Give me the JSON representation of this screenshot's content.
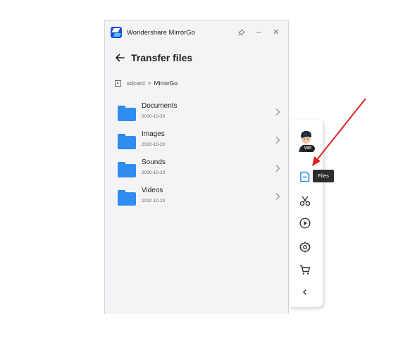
{
  "window": {
    "app_title": "Wondershare MirrorGo",
    "controls": {
      "pin": "pin-icon",
      "minimize": "–",
      "close": "✕"
    }
  },
  "header": {
    "title": "Transfer files"
  },
  "breadcrumb": {
    "root": "sdcard",
    "separator": ">",
    "current": "MirrorGo"
  },
  "folders": [
    {
      "name": "Documents",
      "date": "2020-10-20"
    },
    {
      "name": "Images",
      "date": "2020-10-20"
    },
    {
      "name": "Sounds",
      "date": "2020-10-20"
    },
    {
      "name": "Videos",
      "date": "2020-10-20"
    }
  ],
  "toolbar": {
    "vip_badge": "VIP",
    "tooltip": "Files",
    "items": [
      "files-icon",
      "scissors-icon",
      "play-icon",
      "settings-icon",
      "cart-icon",
      "chevron-left-icon"
    ]
  },
  "colors": {
    "accent": "#2f8cf0",
    "annotation": "#e02020"
  }
}
